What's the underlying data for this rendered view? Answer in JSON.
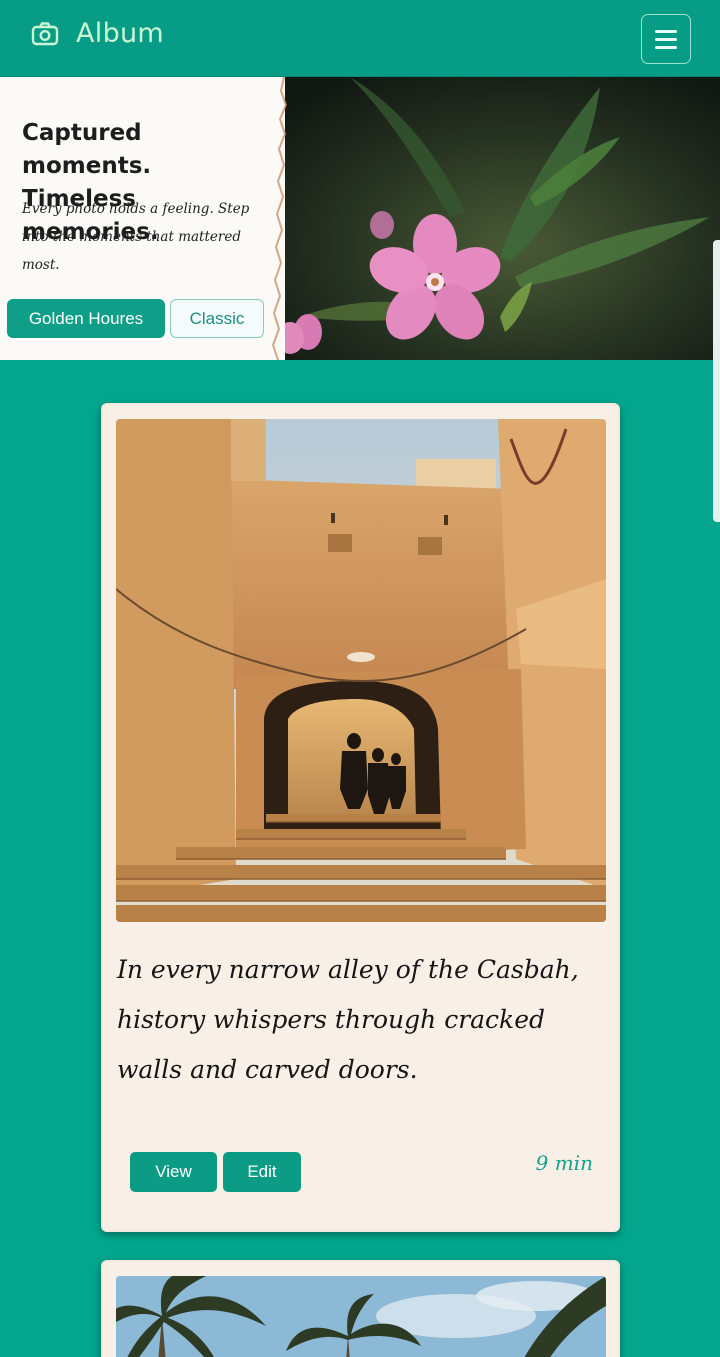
{
  "navbar": {
    "brand_title": "Album",
    "brand_icon": "camera-icon",
    "menu_icon": "hamburger-menu-icon",
    "bg_color": "#079c85",
    "brand_color": "#c9f5d4"
  },
  "hero": {
    "title": "Captured moments. Timeless memories.",
    "subtitle": "Every photo holds a feeling. Step into the moments that mattered most.",
    "primary_button": "Golden Houres",
    "secondary_button": "Classic",
    "image": "pink-flower-photo"
  },
  "cards": [
    {
      "image": "casbah-alley-arch-photo",
      "caption": "In every narrow alley of the Casbah, history whispers through cracked walls and carved doors.",
      "view_label": "View",
      "edit_label": "Edit",
      "read_time": "9 min"
    },
    {
      "image": "palm-trees-sky-photo"
    }
  ],
  "colors": {
    "page_bg": "#03a68d",
    "accent": "#0c9c86",
    "card_bg": "#f8efe6"
  }
}
